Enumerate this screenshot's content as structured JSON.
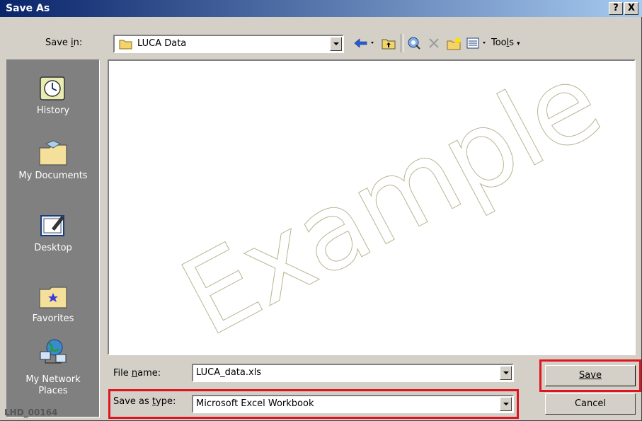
{
  "window": {
    "title": "Save As",
    "help_label": "?",
    "close_label": "X"
  },
  "save_in": {
    "label": "Save in:",
    "value": "LUCA Data"
  },
  "toolbar": {
    "tools_label": "Tools"
  },
  "places": [
    {
      "label": "History",
      "icon": "history-icon"
    },
    {
      "label": "My Documents",
      "icon": "my-documents-icon"
    },
    {
      "label": "Desktop",
      "icon": "desktop-icon"
    },
    {
      "label": "Favorites",
      "icon": "favorites-icon"
    },
    {
      "label": "My Network\nPlaces",
      "icon": "network-places-icon"
    }
  ],
  "file_area": {
    "watermark": "Example"
  },
  "file_name": {
    "label": "File name:",
    "value": "LUCA_data.xls"
  },
  "save_as_type": {
    "label": "Save as type:",
    "value": "Microsoft Excel Workbook"
  },
  "buttons": {
    "save": "Save",
    "cancel": "Cancel"
  },
  "image_code": "LHD_00164",
  "colors": {
    "highlight": "#e0141e",
    "title_start": "#0a246a",
    "title_end": "#a6caf0"
  }
}
